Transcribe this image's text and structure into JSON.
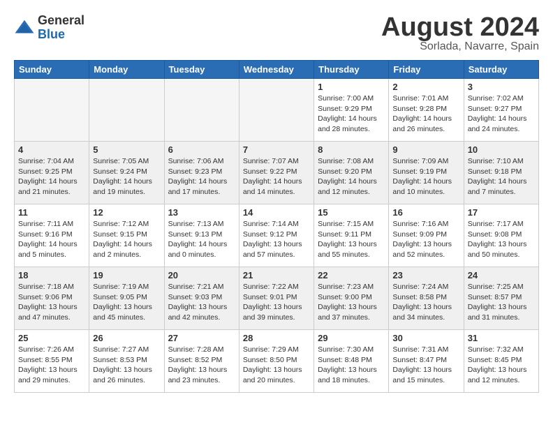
{
  "header": {
    "logo_general": "General",
    "logo_blue": "Blue",
    "month_title": "August 2024",
    "location": "Sorlada, Navarre, Spain"
  },
  "days_of_week": [
    "Sunday",
    "Monday",
    "Tuesday",
    "Wednesday",
    "Thursday",
    "Friday",
    "Saturday"
  ],
  "weeks": [
    [
      {
        "day": "",
        "info": ""
      },
      {
        "day": "",
        "info": ""
      },
      {
        "day": "",
        "info": ""
      },
      {
        "day": "",
        "info": ""
      },
      {
        "day": "1",
        "info": "Sunrise: 7:00 AM\nSunset: 9:29 PM\nDaylight: 14 hours\nand 28 minutes."
      },
      {
        "day": "2",
        "info": "Sunrise: 7:01 AM\nSunset: 9:28 PM\nDaylight: 14 hours\nand 26 minutes."
      },
      {
        "day": "3",
        "info": "Sunrise: 7:02 AM\nSunset: 9:27 PM\nDaylight: 14 hours\nand 24 minutes."
      }
    ],
    [
      {
        "day": "4",
        "info": "Sunrise: 7:04 AM\nSunset: 9:25 PM\nDaylight: 14 hours\nand 21 minutes."
      },
      {
        "day": "5",
        "info": "Sunrise: 7:05 AM\nSunset: 9:24 PM\nDaylight: 14 hours\nand 19 minutes."
      },
      {
        "day": "6",
        "info": "Sunrise: 7:06 AM\nSunset: 9:23 PM\nDaylight: 14 hours\nand 17 minutes."
      },
      {
        "day": "7",
        "info": "Sunrise: 7:07 AM\nSunset: 9:22 PM\nDaylight: 14 hours\nand 14 minutes."
      },
      {
        "day": "8",
        "info": "Sunrise: 7:08 AM\nSunset: 9:20 PM\nDaylight: 14 hours\nand 12 minutes."
      },
      {
        "day": "9",
        "info": "Sunrise: 7:09 AM\nSunset: 9:19 PM\nDaylight: 14 hours\nand 10 minutes."
      },
      {
        "day": "10",
        "info": "Sunrise: 7:10 AM\nSunset: 9:18 PM\nDaylight: 14 hours\nand 7 minutes."
      }
    ],
    [
      {
        "day": "11",
        "info": "Sunrise: 7:11 AM\nSunset: 9:16 PM\nDaylight: 14 hours\nand 5 minutes."
      },
      {
        "day": "12",
        "info": "Sunrise: 7:12 AM\nSunset: 9:15 PM\nDaylight: 14 hours\nand 2 minutes."
      },
      {
        "day": "13",
        "info": "Sunrise: 7:13 AM\nSunset: 9:13 PM\nDaylight: 14 hours\nand 0 minutes."
      },
      {
        "day": "14",
        "info": "Sunrise: 7:14 AM\nSunset: 9:12 PM\nDaylight: 13 hours\nand 57 minutes."
      },
      {
        "day": "15",
        "info": "Sunrise: 7:15 AM\nSunset: 9:11 PM\nDaylight: 13 hours\nand 55 minutes."
      },
      {
        "day": "16",
        "info": "Sunrise: 7:16 AM\nSunset: 9:09 PM\nDaylight: 13 hours\nand 52 minutes."
      },
      {
        "day": "17",
        "info": "Sunrise: 7:17 AM\nSunset: 9:08 PM\nDaylight: 13 hours\nand 50 minutes."
      }
    ],
    [
      {
        "day": "18",
        "info": "Sunrise: 7:18 AM\nSunset: 9:06 PM\nDaylight: 13 hours\nand 47 minutes."
      },
      {
        "day": "19",
        "info": "Sunrise: 7:19 AM\nSunset: 9:05 PM\nDaylight: 13 hours\nand 45 minutes."
      },
      {
        "day": "20",
        "info": "Sunrise: 7:21 AM\nSunset: 9:03 PM\nDaylight: 13 hours\nand 42 minutes."
      },
      {
        "day": "21",
        "info": "Sunrise: 7:22 AM\nSunset: 9:01 PM\nDaylight: 13 hours\nand 39 minutes."
      },
      {
        "day": "22",
        "info": "Sunrise: 7:23 AM\nSunset: 9:00 PM\nDaylight: 13 hours\nand 37 minutes."
      },
      {
        "day": "23",
        "info": "Sunrise: 7:24 AM\nSunset: 8:58 PM\nDaylight: 13 hours\nand 34 minutes."
      },
      {
        "day": "24",
        "info": "Sunrise: 7:25 AM\nSunset: 8:57 PM\nDaylight: 13 hours\nand 31 minutes."
      }
    ],
    [
      {
        "day": "25",
        "info": "Sunrise: 7:26 AM\nSunset: 8:55 PM\nDaylight: 13 hours\nand 29 minutes."
      },
      {
        "day": "26",
        "info": "Sunrise: 7:27 AM\nSunset: 8:53 PM\nDaylight: 13 hours\nand 26 minutes."
      },
      {
        "day": "27",
        "info": "Sunrise: 7:28 AM\nSunset: 8:52 PM\nDaylight: 13 hours\nand 23 minutes."
      },
      {
        "day": "28",
        "info": "Sunrise: 7:29 AM\nSunset: 8:50 PM\nDaylight: 13 hours\nand 20 minutes."
      },
      {
        "day": "29",
        "info": "Sunrise: 7:30 AM\nSunset: 8:48 PM\nDaylight: 13 hours\nand 18 minutes."
      },
      {
        "day": "30",
        "info": "Sunrise: 7:31 AM\nSunset: 8:47 PM\nDaylight: 13 hours\nand 15 minutes."
      },
      {
        "day": "31",
        "info": "Sunrise: 7:32 AM\nSunset: 8:45 PM\nDaylight: 13 hours\nand 12 minutes."
      }
    ]
  ]
}
